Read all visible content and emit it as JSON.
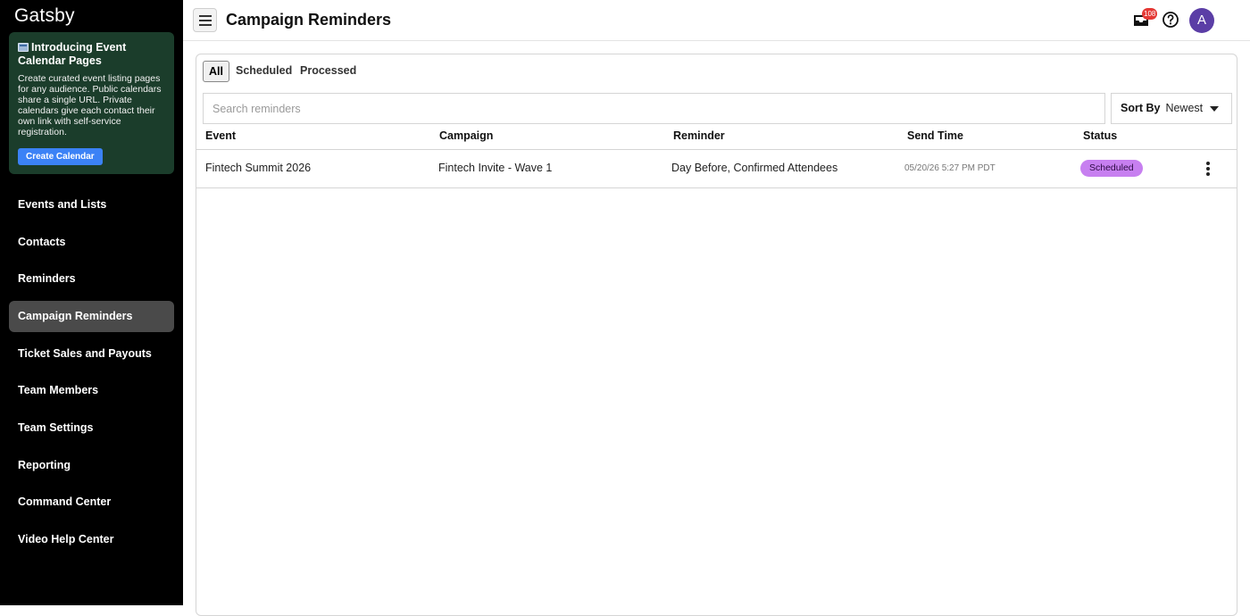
{
  "sidebar": {
    "logo": "Gatsby",
    "promo": {
      "title": "Introducing Event Calendar Pages",
      "body": "Create curated event listing pages for any audience. Public calendars share a single URL. Private calendars give each contact their own link with self-service registration.",
      "button": "Create Calendar"
    },
    "items": [
      {
        "label": "Events and Lists"
      },
      {
        "label": "Contacts"
      },
      {
        "label": "Reminders"
      },
      {
        "label": "Campaign Reminders",
        "active": true
      },
      {
        "label": "Ticket Sales and Payouts"
      },
      {
        "label": "Team Members"
      },
      {
        "label": "Team Settings"
      },
      {
        "label": "Reporting"
      },
      {
        "label": "Command Center"
      },
      {
        "label": "Video Help Center"
      }
    ]
  },
  "header": {
    "title": "Campaign Reminders",
    "inbox_count": "108",
    "avatar_initial": "A",
    "icons": [
      "menu-icon",
      "inbox-icon",
      "help-icon"
    ]
  },
  "tabs": [
    {
      "label": "All",
      "active": true
    },
    {
      "label": "Scheduled"
    },
    {
      "label": "Processed"
    }
  ],
  "search": {
    "placeholder": "Search reminders",
    "value": ""
  },
  "sort": {
    "label": "Sort By",
    "value": "Newest"
  },
  "table": {
    "columns": [
      "Event",
      "Campaign",
      "Reminder",
      "Send Time",
      "Status"
    ],
    "rows": [
      {
        "event": "Fintech Summit 2026",
        "campaign": "Fintech Invite - Wave 1",
        "reminder": "Day Before, Confirmed Attendees",
        "send_time": "05/20/26 5:27 PM PDT",
        "status": "Scheduled"
      }
    ]
  },
  "colors": {
    "sidebar_bg": "#000000",
    "promo_bg": "#1b3d2b",
    "promo_button": "#3b82f6",
    "active_nav": "#4a4a4a",
    "status_pill": "#c77ff0",
    "avatar": "#5b3ea6",
    "badge": "#e53935"
  }
}
